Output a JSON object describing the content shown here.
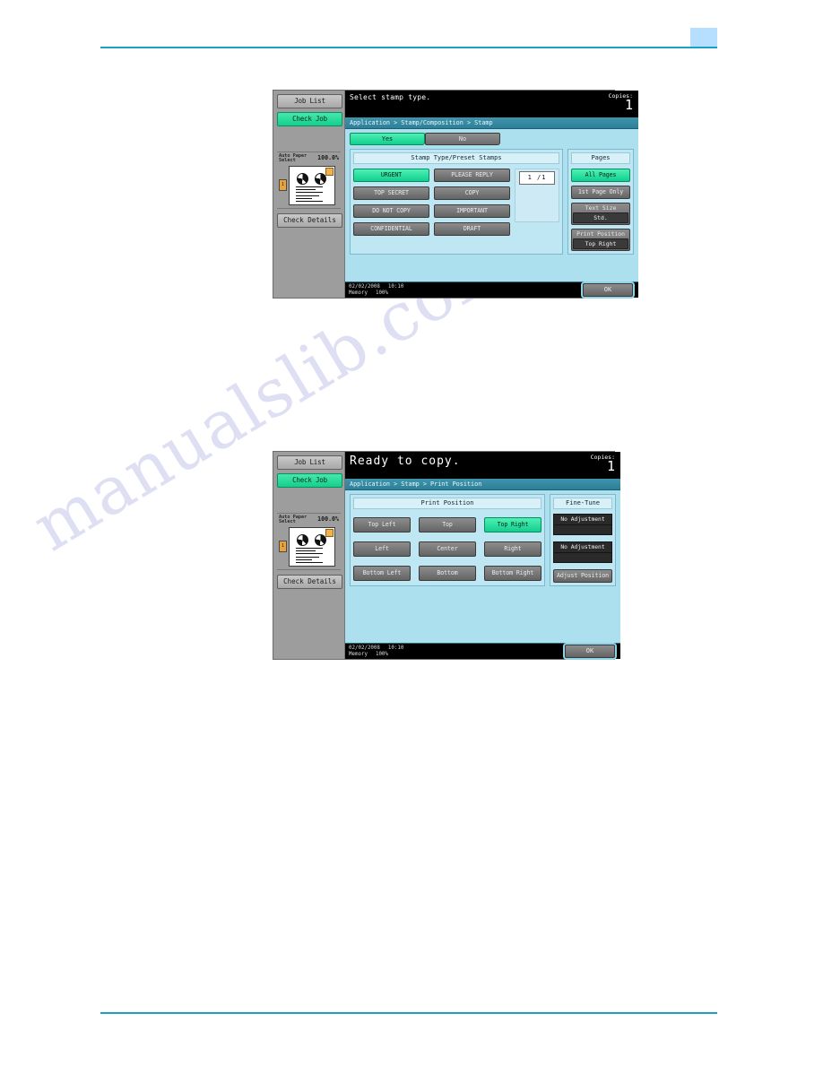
{
  "page": {
    "watermark": "manualslib.com"
  },
  "panels": [
    {
      "message": "Select stamp type.",
      "copies_label": "Copies:",
      "copies_value": "1",
      "breadcrumb": "Application > Stamp/Composition > Stamp",
      "tabs": [
        {
          "label": "Yes",
          "selected": true
        },
        {
          "label": "No",
          "selected": false
        }
      ],
      "main_section_title": "Stamp Type/Preset Stamps",
      "stamps_left": [
        "URGENT",
        "TOP SECRET",
        "DO NOT COPY",
        "CONFIDENTIAL"
      ],
      "stamps_right": [
        "PLEASE REPLY",
        "COPY",
        "IMPORTANT",
        "DRAFT"
      ],
      "selected_stamp": "URGENT",
      "counter": "1  /1",
      "side_section_title": "Pages",
      "pages_buttons": [
        {
          "label": "All Pages",
          "selected": true
        },
        {
          "label": "1st Page Only",
          "selected": false
        }
      ],
      "text_size": {
        "caption": "Text Size",
        "value": "Std."
      },
      "print_position": {
        "caption": "Print Position",
        "value": "Top Right"
      },
      "status": {
        "date": "02/02/2008",
        "time": "10:10",
        "memory_label": "Memory",
        "memory_value": "100%"
      },
      "ok_label": "OK"
    },
    {
      "message": "Ready to copy.",
      "copies_label": "Copies:",
      "copies_value": "1",
      "breadcrumb": "Application > Stamp > Print Position",
      "main_section_title": "Print Position",
      "position_rows": [
        [
          {
            "label": "Top Left",
            "selected": false
          },
          {
            "label": "Top",
            "selected": false
          },
          {
            "label": "Top Right",
            "selected": true
          }
        ],
        [
          {
            "label": "Left",
            "selected": false
          },
          {
            "label": "Center",
            "selected": false
          },
          {
            "label": "Right",
            "selected": false
          }
        ],
        [
          {
            "label": "Bottom Left",
            "selected": false
          },
          {
            "label": "Bottom",
            "selected": false
          },
          {
            "label": "Bottom Right",
            "selected": false
          }
        ]
      ],
      "side_section_title": "Fine-Tune",
      "fine_tune": [
        {
          "display": "No Adjustment",
          "field": ""
        },
        {
          "display": "No Adjustment",
          "field": ""
        }
      ],
      "adjust_position_label": "Adjust Position",
      "status": {
        "date": "02/02/2008",
        "time": "10:10",
        "memory_label": "Memory",
        "memory_value": "100%"
      },
      "ok_label": "OK"
    }
  ],
  "rail": {
    "job_list": "Job List",
    "check_job": "Check Job",
    "paper_label_line1": "Auto Paper",
    "paper_label_line2": "Select",
    "zoom": "100.0%",
    "tray_number": "1",
    "check_details": "Check Details"
  }
}
